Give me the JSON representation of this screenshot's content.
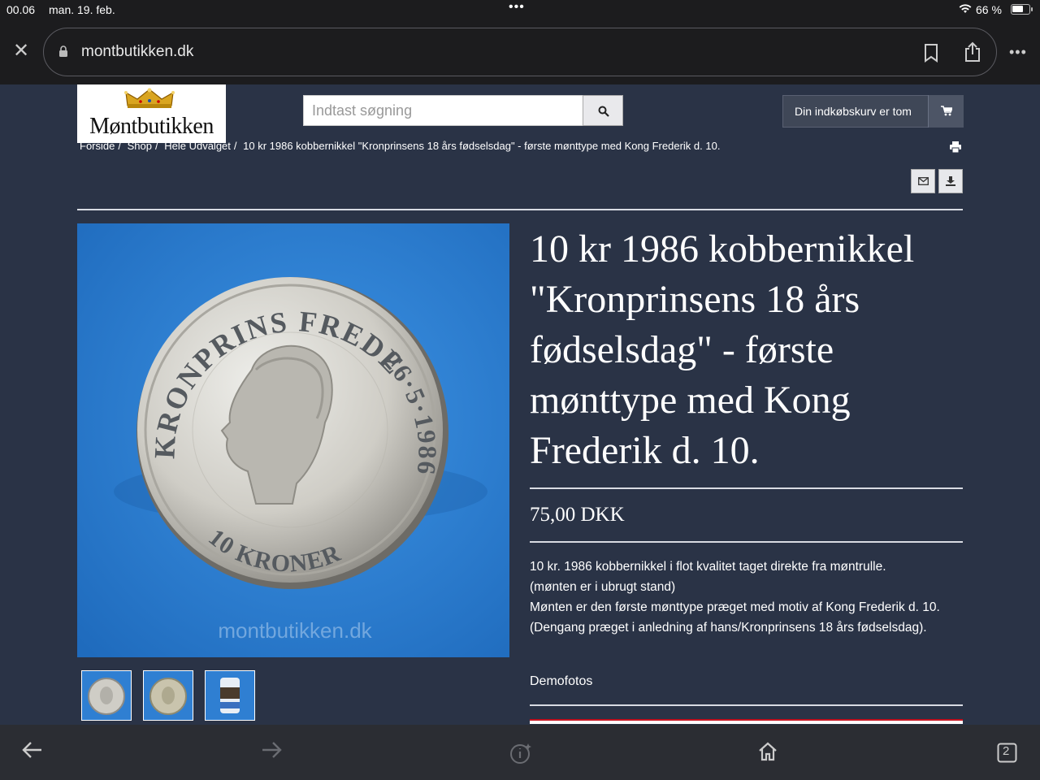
{
  "status": {
    "time": "00.06",
    "date": "man. 19. feb.",
    "battery": "66 %",
    "battery_level": 0.66
  },
  "browser": {
    "url": "montbutikken.dk"
  },
  "site": {
    "logo_text": "Møntbutikken",
    "search_placeholder": "Indtast søgning",
    "cart_label": "Din indkøbskurv er tom"
  },
  "breadcrumb": [
    "Forside",
    "Shop",
    "Hele Udvalget",
    "10 kr 1986 kobbernikkel \"Kronprinsens 18 års fødselsdag\" - første mønttype med Kong Frederik d. 10."
  ],
  "product": {
    "title": "10 kr 1986 kobbernikkel \"Kronprinsens 18 års fødselsdag\" - første mønttype med Kong Frederik d. 10.",
    "price": "75,00 DKK",
    "description": [
      "10 kr. 1986 kobbernikkel i flot kvalitet taget direkte fra møntrulle.",
      "(mønten er i ubrugt stand)",
      "Mønten er den første mønttype præget med motiv af Kong Frederik d. 10.",
      "(Dengang præget i anledning af hans/Kronprinsens 18 års fødselsdag)."
    ],
    "demo_label": "Demofotos",
    "image": {
      "top_legend": "KRONPRINS FREDERIK",
      "date_legend": "26·5·1986",
      "denomination": "10 KRONER",
      "watermark": "montbutikken.dk"
    }
  },
  "icons": {
    "close": "close-icon",
    "lock": "lock-icon",
    "bookmark": "bookmark-icon",
    "share": "share-icon",
    "search": "search-icon",
    "cart": "cart-icon",
    "print": "print-icon",
    "mail": "mail-icon",
    "download": "download-icon",
    "back": "back-arrow-icon",
    "forward": "forward-arrow-icon",
    "info": "info-icon",
    "home": "home-icon",
    "tabs": "tabs-icon"
  },
  "tabs_count": "2"
}
